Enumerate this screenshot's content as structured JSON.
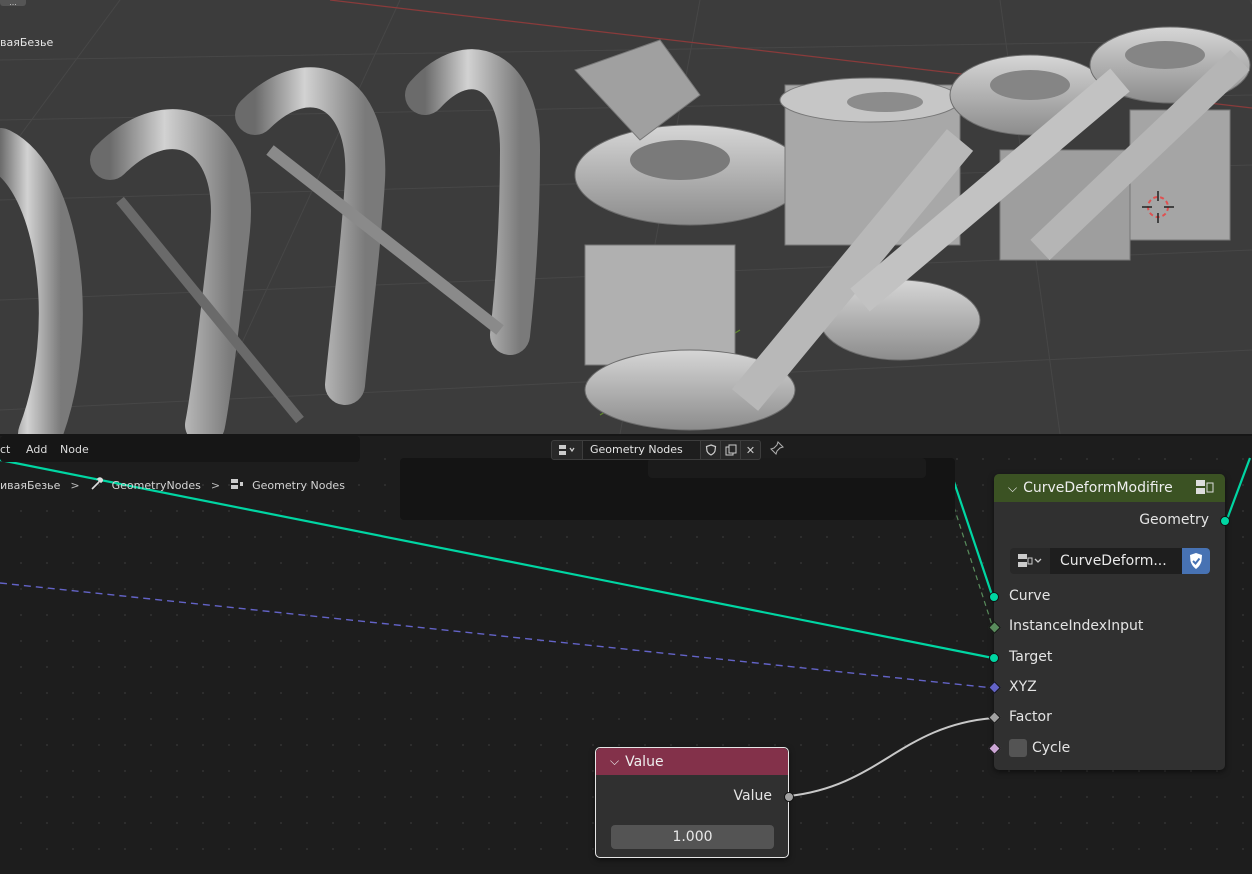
{
  "viewport": {
    "object_label": "ваяБезье",
    "corner_label": "..."
  },
  "menubar": {
    "items": [
      "ct",
      "Add",
      "Node"
    ]
  },
  "tree_selector": {
    "icon": "node-tree-icon",
    "name": "Geometry Nodes",
    "fake_user": "shield-icon",
    "duplicate": "duplicate-icon",
    "close": "close-icon",
    "pin": "pin-icon"
  },
  "breadcrumb": {
    "object": "иваяБезье",
    "modifier": "GeometryNodes",
    "tree": "Geometry Nodes"
  },
  "curve_deform_node": {
    "title": "CurveDeformModifire",
    "output": "Geometry",
    "group_name": "CurveDeform...",
    "inputs": [
      "Curve",
      "InstanceIndexInput",
      "Target",
      "XYZ",
      "Factor",
      "Cycle"
    ],
    "colors": {
      "header": "#3b5223",
      "geometry": "#00d6a3",
      "int": "#598c5c",
      "vector": "#6363c7",
      "float": "#a1a1a1",
      "bool": "#cca6d6"
    }
  },
  "value_node": {
    "title": "Value",
    "output": "Value",
    "value": "1.000",
    "colors": {
      "header": "#83314a"
    }
  }
}
